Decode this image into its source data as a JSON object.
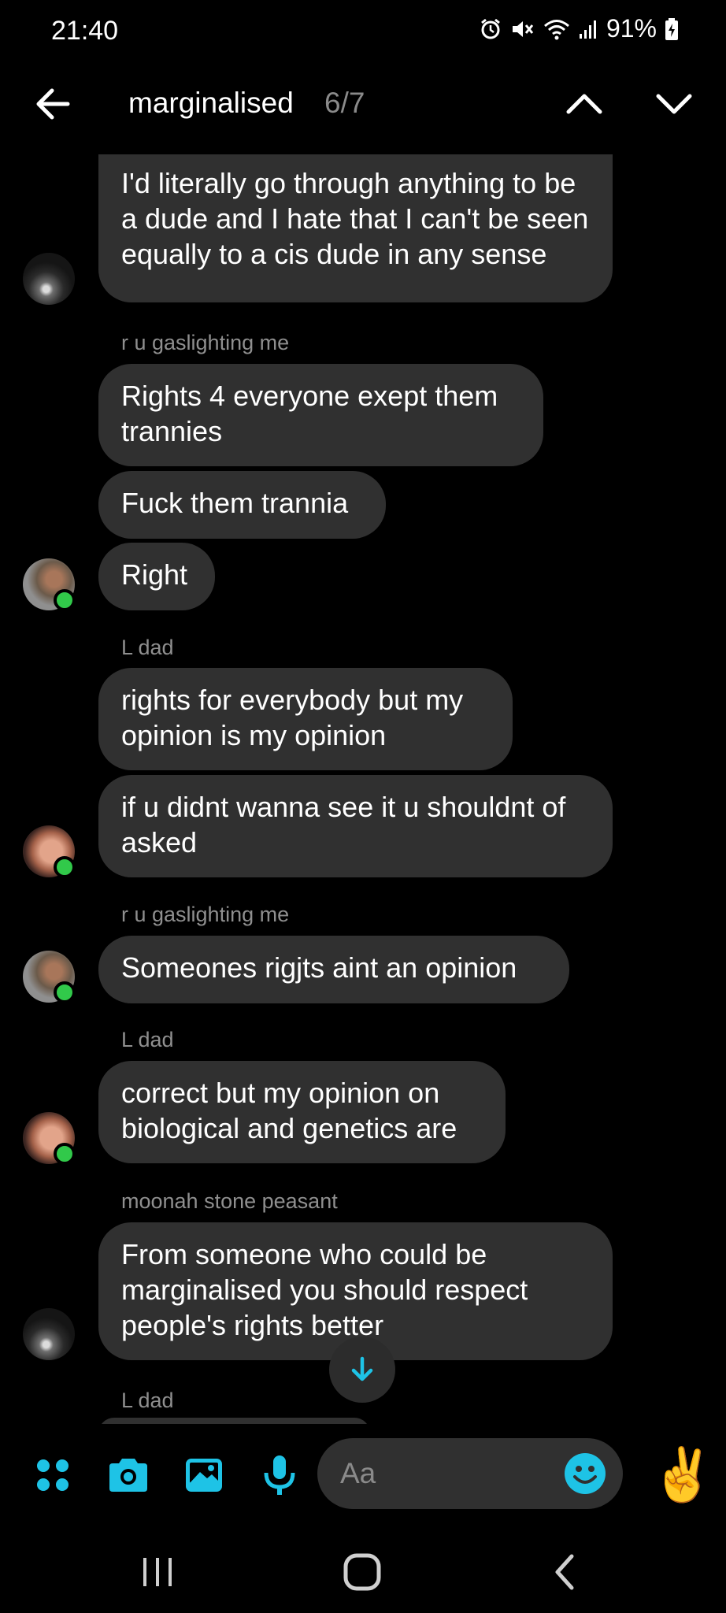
{
  "status_bar": {
    "time": "21:40",
    "battery": "91%"
  },
  "header": {
    "search_query": "marginalised",
    "match_count": "6/7"
  },
  "messages": [
    {
      "text": "I'd literally go through anything to be a dude and I hate that I can't be seen equally to a cis dude in any sense"
    },
    {
      "sender": "r u gaslighting me"
    },
    {
      "text": "Rights 4 everyone exept them trannies"
    },
    {
      "text": "Fuck them trannia"
    },
    {
      "text": "Right"
    },
    {
      "sender": "L dad"
    },
    {
      "text": "rights for everybody but my opinion is my opinion"
    },
    {
      "text": "if u didnt wanna see it u shouldnt of asked"
    },
    {
      "sender": "r u gaslighting me"
    },
    {
      "text": "Someones rigjts aint an opinion"
    },
    {
      "sender": "L dad"
    },
    {
      "text": "correct but my opinion on biological and genetics are"
    },
    {
      "sender": "moonah stone peasant"
    },
    {
      "text": "From someone who could be marginalised you should respect people's rights better"
    },
    {
      "sender": "L dad"
    }
  ],
  "composer": {
    "placeholder": "Aa",
    "quick_emoji": "✌️"
  },
  "colors": {
    "accent": "#1ec3e6",
    "bubble": "#303030",
    "online": "#31c94a"
  }
}
